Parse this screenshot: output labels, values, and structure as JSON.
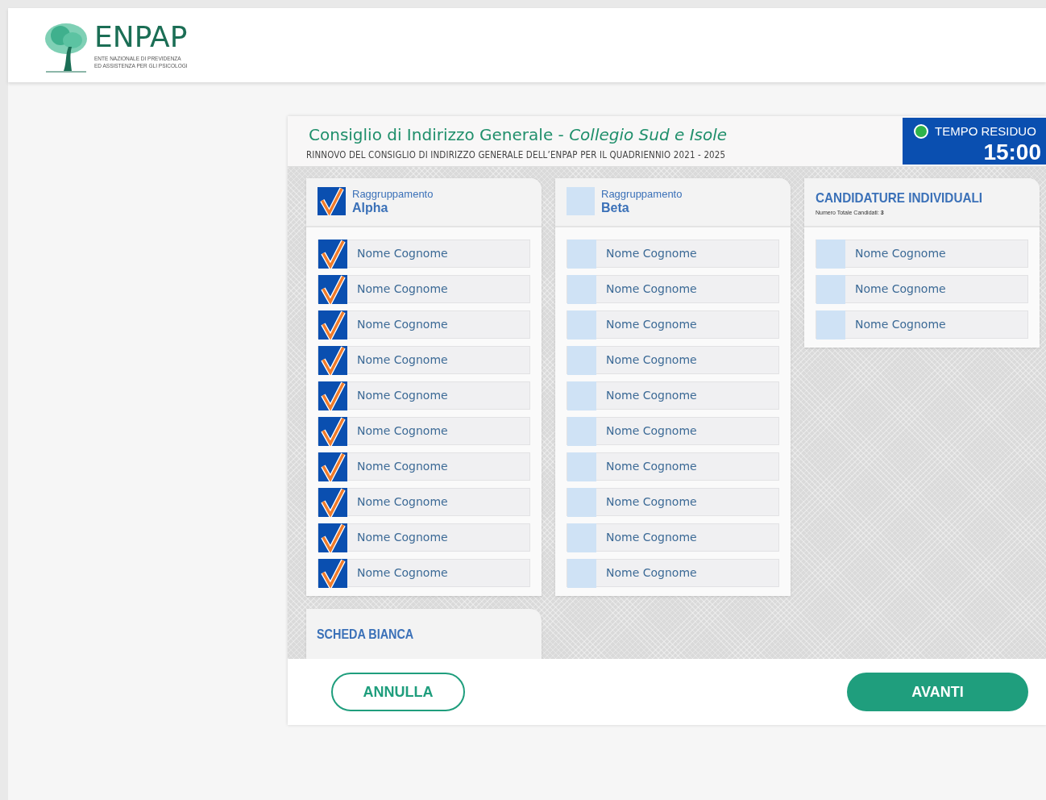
{
  "logo": {
    "name": "ENPAP",
    "subtitle_lines": [
      "ENTE NAZIONALE DI PREVIDENZA",
      "ED ASSISTENZA PER GLI PSICOLOGI"
    ]
  },
  "ballot": {
    "title": "Consiglio di Indirizzo Generale -",
    "college": "Collegio Sud e Isole",
    "subtitle": "RINNOVO DEL CONSIGLIO DI INDIRIZZO GENERALE DELL’ENPAP PER IL QUADRIENNIO  2021 - 2025"
  },
  "timer": {
    "label": "TEMPO RESIDUO",
    "value": "15:00",
    "active": true
  },
  "groups": [
    {
      "kind": "list",
      "label": "Raggruppamento",
      "name": "Alpha",
      "selected": true,
      "candidates": [
        {
          "name": "Nome Cognome",
          "checked": true
        },
        {
          "name": "Nome Cognome",
          "checked": true
        },
        {
          "name": "Nome Cognome",
          "checked": true
        },
        {
          "name": "Nome Cognome",
          "checked": true
        },
        {
          "name": "Nome Cognome",
          "checked": true
        },
        {
          "name": "Nome Cognome",
          "checked": true
        },
        {
          "name": "Nome Cognome",
          "checked": true
        },
        {
          "name": "Nome Cognome",
          "checked": true
        },
        {
          "name": "Nome Cognome",
          "checked": true
        },
        {
          "name": "Nome Cognome",
          "checked": true
        }
      ]
    },
    {
      "kind": "list",
      "label": "Raggruppamento",
      "name": "Beta",
      "selected": false,
      "candidates": [
        {
          "name": "Nome Cognome",
          "checked": false
        },
        {
          "name": "Nome Cognome",
          "checked": false
        },
        {
          "name": "Nome Cognome",
          "checked": false
        },
        {
          "name": "Nome Cognome",
          "checked": false
        },
        {
          "name": "Nome Cognome",
          "checked": false
        },
        {
          "name": "Nome Cognome",
          "checked": false
        },
        {
          "name": "Nome Cognome",
          "checked": false
        },
        {
          "name": "Nome Cognome",
          "checked": false
        },
        {
          "name": "Nome Cognome",
          "checked": false
        },
        {
          "name": "Nome Cognome",
          "checked": false
        }
      ]
    },
    {
      "kind": "individual",
      "title": "CANDIDATURE INDIVIDUALI",
      "count_text": "Numero Totale Candidati: **3**",
      "candidates": [
        {
          "name": "Nome Cognome",
          "checked": false
        },
        {
          "name": "Nome Cognome",
          "checked": false
        },
        {
          "name": "Nome Cognome",
          "checked": false
        }
      ]
    }
  ],
  "blank_ballot": {
    "label": "SCHEDA BIANCA"
  },
  "buttons": {
    "cancel": "ANNULLA",
    "next": "AVANTI"
  }
}
